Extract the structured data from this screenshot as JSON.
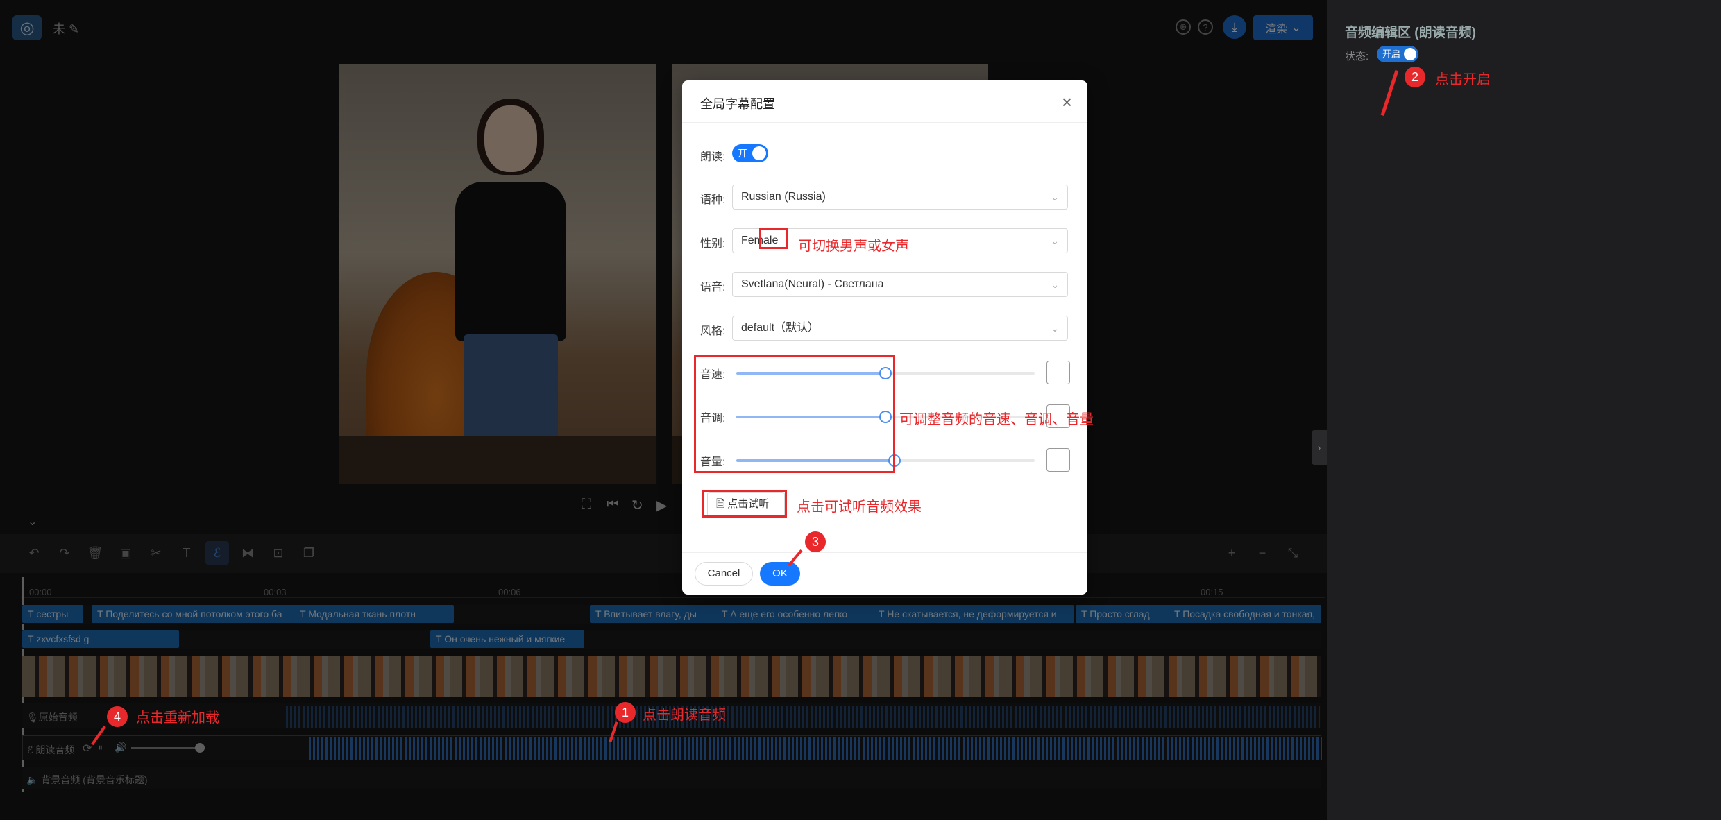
{
  "app": {
    "project_name": "未",
    "render_label": "渲染",
    "logo_icon": "snail-logo-icon"
  },
  "player": {
    "icons": [
      "fullscreen-icon",
      "prev-frame-icon",
      "replay-icon",
      "play-icon"
    ]
  },
  "timeline": {
    "ticks": [
      "00:00",
      "00:03",
      "00:06",
      "00:15"
    ],
    "subtitle_clips": [
      "сестры",
      "Поделитесь со мной потолком этого ба",
      "Модальная ткань плотн",
      "Впитывает влагу, ды",
      "А еще его особенно легко",
      "Не скатывается, не деформируется и",
      "Просто сглад",
      "Посадка свободная и тонкая,"
    ],
    "subtitle_clips_row2": [
      "zxvcfxsfsd g",
      "Он очень нежный и мягкие"
    ],
    "tracks": {
      "original_audio": "原始音频",
      "read_audio": "朗读音频",
      "bg_audio": "背景音频 (背景音乐标题)"
    }
  },
  "right_panel": {
    "title": "音频编辑区 (朗读音频)",
    "status_label": "状态:",
    "status_value": "开启"
  },
  "modal": {
    "title": "全局字幕配置",
    "read_label": "朗读:",
    "read_switch": "开",
    "language_label": "语种:",
    "language_value": "Russian (Russia)",
    "gender_label": "性别:",
    "gender_value": "Female",
    "voice_label": "语音:",
    "voice_value": "Svetlana(Neural) - Светлана",
    "style_label": "风格:",
    "style_value": "default（默认）",
    "speed_label": "音速:",
    "pitch_label": "音调:",
    "volume_label": "音量:",
    "speed_value": 0.5,
    "pitch_value": 0.5,
    "volume_value": 0.53,
    "try_label": "点击试听",
    "cancel_label": "Cancel",
    "ok_label": "OK"
  },
  "annotations": {
    "n1": "1",
    "n1_text": "点击朗读音频",
    "n2": "2",
    "n2_text": "点击开启",
    "n3": "3",
    "n4": "4",
    "n4_text": "点击重新加载",
    "gender_note": "可切换男声或女声",
    "slider_note": "可调整音频的音速、音调、音量",
    "try_note": "点击可试听音频效果",
    "color": "#e8282b"
  }
}
